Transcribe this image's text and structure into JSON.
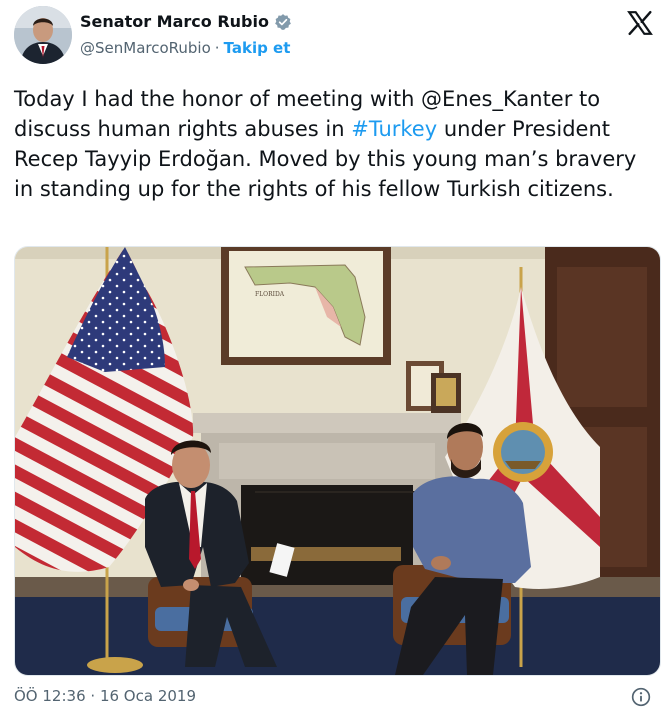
{
  "author": {
    "display_name": "Senator Marco Rubio",
    "handle": "@SenMarcoRubio",
    "separator": "·",
    "follow_label": "Takip et"
  },
  "tweet": {
    "text_part1": "Today I had the honor of meeting with @Enes_Kanter to discuss human rights abuses in ",
    "hashtag": "#Turkey",
    "text_part2": " under President Recep Tayyip Erdoğan. Moved by this young man’s bravery in standing up for the rights of his fellow Turkish citizens."
  },
  "photo": {
    "map_label": "FLORIDA"
  },
  "footer": {
    "time": "ÖÖ 12:36",
    "separator": "·",
    "date": "16 Oca 2019"
  },
  "colors": {
    "link": "#1d9bf0",
    "secondary_text": "#536471",
    "verified": "#829aab"
  },
  "icons": [
    "verified-badge-icon",
    "x-logo-icon",
    "info-icon"
  ]
}
